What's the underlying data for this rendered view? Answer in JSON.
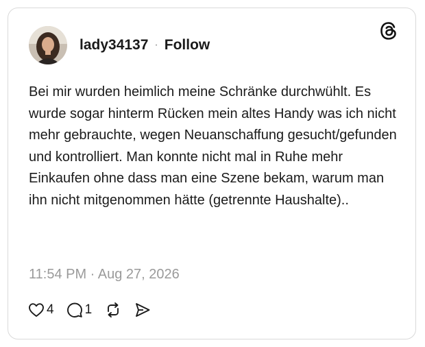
{
  "post": {
    "username": "lady34137",
    "separator": "·",
    "follow_label": "Follow",
    "text": "Bei mir wurden heimlich meine Schränke durchwühlt. Es wurde sogar hinterm Rücken mein altes Handy was ich nicht mehr gebrauchte, wegen Neuanschaffung gesucht/gefunden und kontrolliert. Man konnte nicht mal in Ruhe mehr Einkaufen ohne dass man eine Szene bekam, warum man ihn nicht mitgenommen hätte (getrennte Haushalte)..",
    "timestamp": "11:54 PM · Aug 27, 2026"
  },
  "actions": {
    "like": {
      "icon": "heart-icon",
      "count": "4"
    },
    "reply": {
      "icon": "comment-icon",
      "count": "1"
    },
    "repost": {
      "icon": "repost-icon"
    },
    "share": {
      "icon": "send-icon"
    }
  },
  "brand": {
    "icon": "threads-logo-icon"
  }
}
